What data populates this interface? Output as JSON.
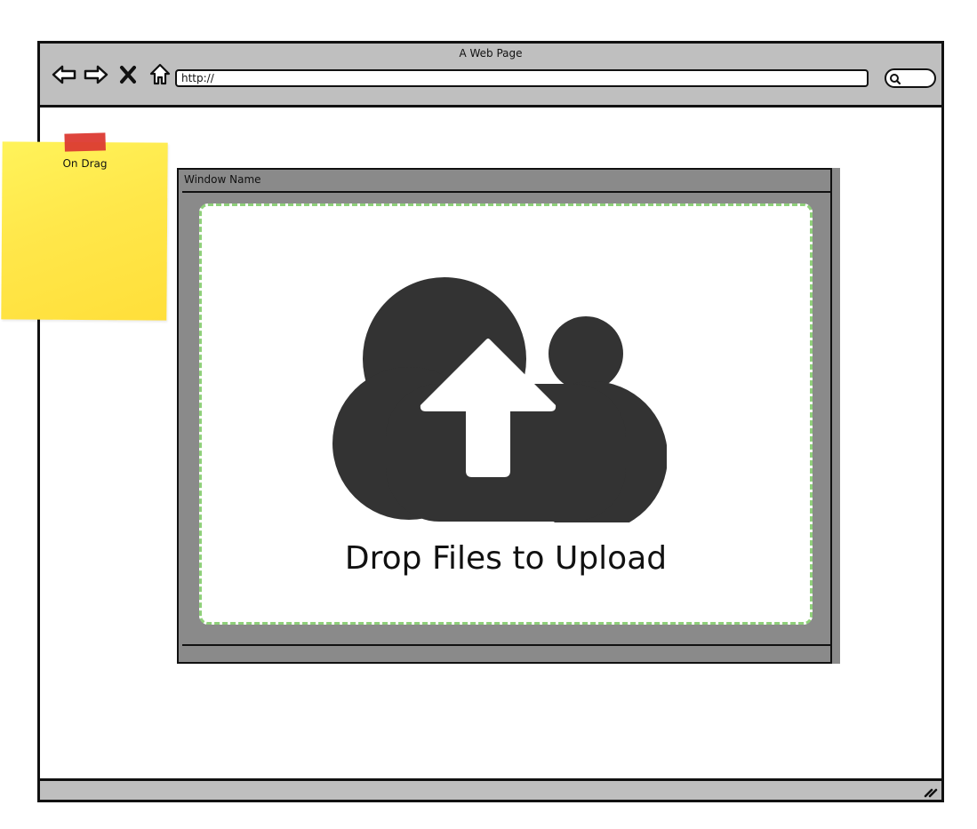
{
  "browser": {
    "title": "A Web Page",
    "url": "http://",
    "nav_icons": [
      "back-arrow-icon",
      "forward-arrow-icon",
      "close-icon",
      "home-icon"
    ],
    "search_icon": "search-icon"
  },
  "sticky_note": {
    "label": "On Drag",
    "color": "#ffe74a",
    "tape_color": "#dc3a32"
  },
  "window": {
    "title": "Window Name"
  },
  "drop_zone": {
    "text": "Drop Files to Upload",
    "icon": "cloud-upload-icon",
    "border_color": "#8fd07a",
    "icon_color": "#333333"
  }
}
